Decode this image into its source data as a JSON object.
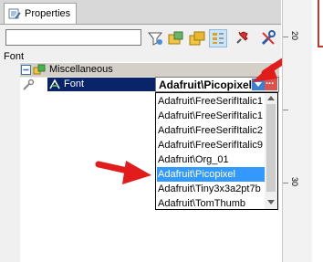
{
  "panel": {
    "tab_label": "Properties",
    "search_placeholder": ""
  },
  "toolbar": {
    "buttons": [
      "filter-icon",
      "events-icon",
      "properties-icon",
      "categorized-icon",
      "pin-icon",
      "tools-icon"
    ]
  },
  "section_label": "Font",
  "grid": {
    "category": "Miscellaneous",
    "property_name": "Font",
    "property_value": "Adafruit\\Picopixel",
    "ellipsis": "..."
  },
  "dropdown": {
    "items": [
      "Adafruit\\FreeSerifItalic1",
      "Adafruit\\FreeSerifItalic1",
      "Adafruit\\FreeSerifItalic2",
      "Adafruit\\FreeSerifItalic9",
      "Adafruit\\Org_01",
      "Adafruit\\Picopixel",
      "Adafruit\\Tiny3x3a2pt7b",
      "Adafruit\\TomThumb"
    ],
    "selected_index": 5
  },
  "ruler": {
    "ticks": [
      "20",
      "30"
    ]
  },
  "colors": {
    "selection": "#3399ff",
    "arrow": "#e21b1b",
    "category_bg": "#d4d0c8"
  }
}
